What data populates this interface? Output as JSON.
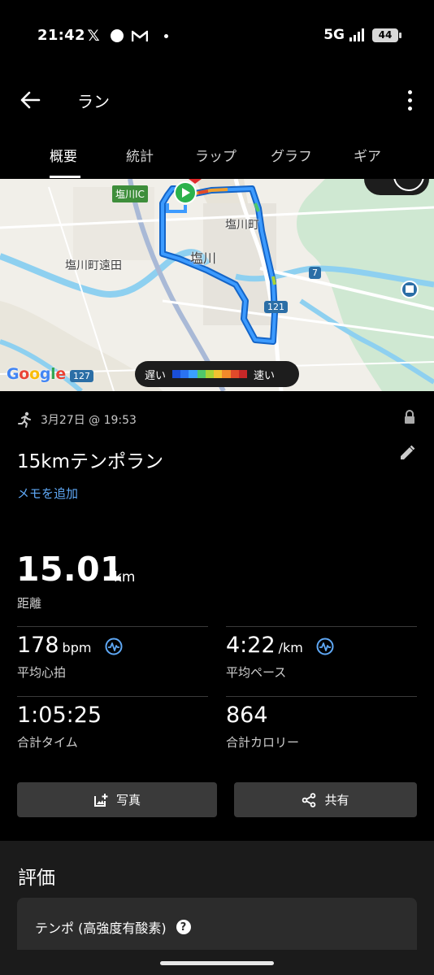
{
  "status_bar": {
    "time": "21:42",
    "network": "5G",
    "battery": "44",
    "icons": [
      "x-icon",
      "circle-icon",
      "gmail-icon",
      "dot-icon",
      "signal-icon",
      "battery-icon"
    ]
  },
  "app_bar": {
    "title": "ラン",
    "back_icon": "arrow-left-icon",
    "more_icon": "more-vert-icon"
  },
  "tabs": [
    {
      "label": "概要",
      "active": true
    },
    {
      "label": "統計",
      "active": false
    },
    {
      "label": "ラップ",
      "active": false
    },
    {
      "label": "グラフ",
      "active": false
    },
    {
      "label": "ギア",
      "active": false
    }
  ],
  "map": {
    "labels": {
      "ic": "塩川IC",
      "town": "塩川町",
      "station": "塩川",
      "area": "塩川町遠田"
    },
    "route_numbers": [
      "7",
      "121",
      "127"
    ],
    "provider": "Google",
    "speed_legend": {
      "slow": "遅い",
      "fast": "速い"
    },
    "speed_colors": [
      "#1a4fd8",
      "#2a73f0",
      "#3aa0ff",
      "#4fc86a",
      "#a9d336",
      "#f2c230",
      "#f28a2a",
      "#e04a2a",
      "#c62828"
    ],
    "route_color": "#1e88ff"
  },
  "activity": {
    "date": "3月27日 @ 19:53",
    "title": "15kmテンポラン",
    "memo_link": "メモを追加"
  },
  "stats": {
    "distance": {
      "value": "15.01",
      "unit": "km",
      "label": "距離"
    },
    "avg_hr": {
      "value": "178",
      "unit": "bpm",
      "label": "平均心拍"
    },
    "avg_pace": {
      "value": "4:22",
      "unit": "/km",
      "label": "平均ペース"
    },
    "total_time": {
      "value": "1:05:25",
      "label": "合計タイム"
    },
    "calories": {
      "value": "864",
      "label": "合計カロリー"
    }
  },
  "actions": {
    "photo": "写真",
    "share": "共有"
  },
  "evaluation": {
    "heading": "評価",
    "card_title": "テンポ (高強度有酸素)",
    "card_sub": "...",
    "help": "?"
  }
}
